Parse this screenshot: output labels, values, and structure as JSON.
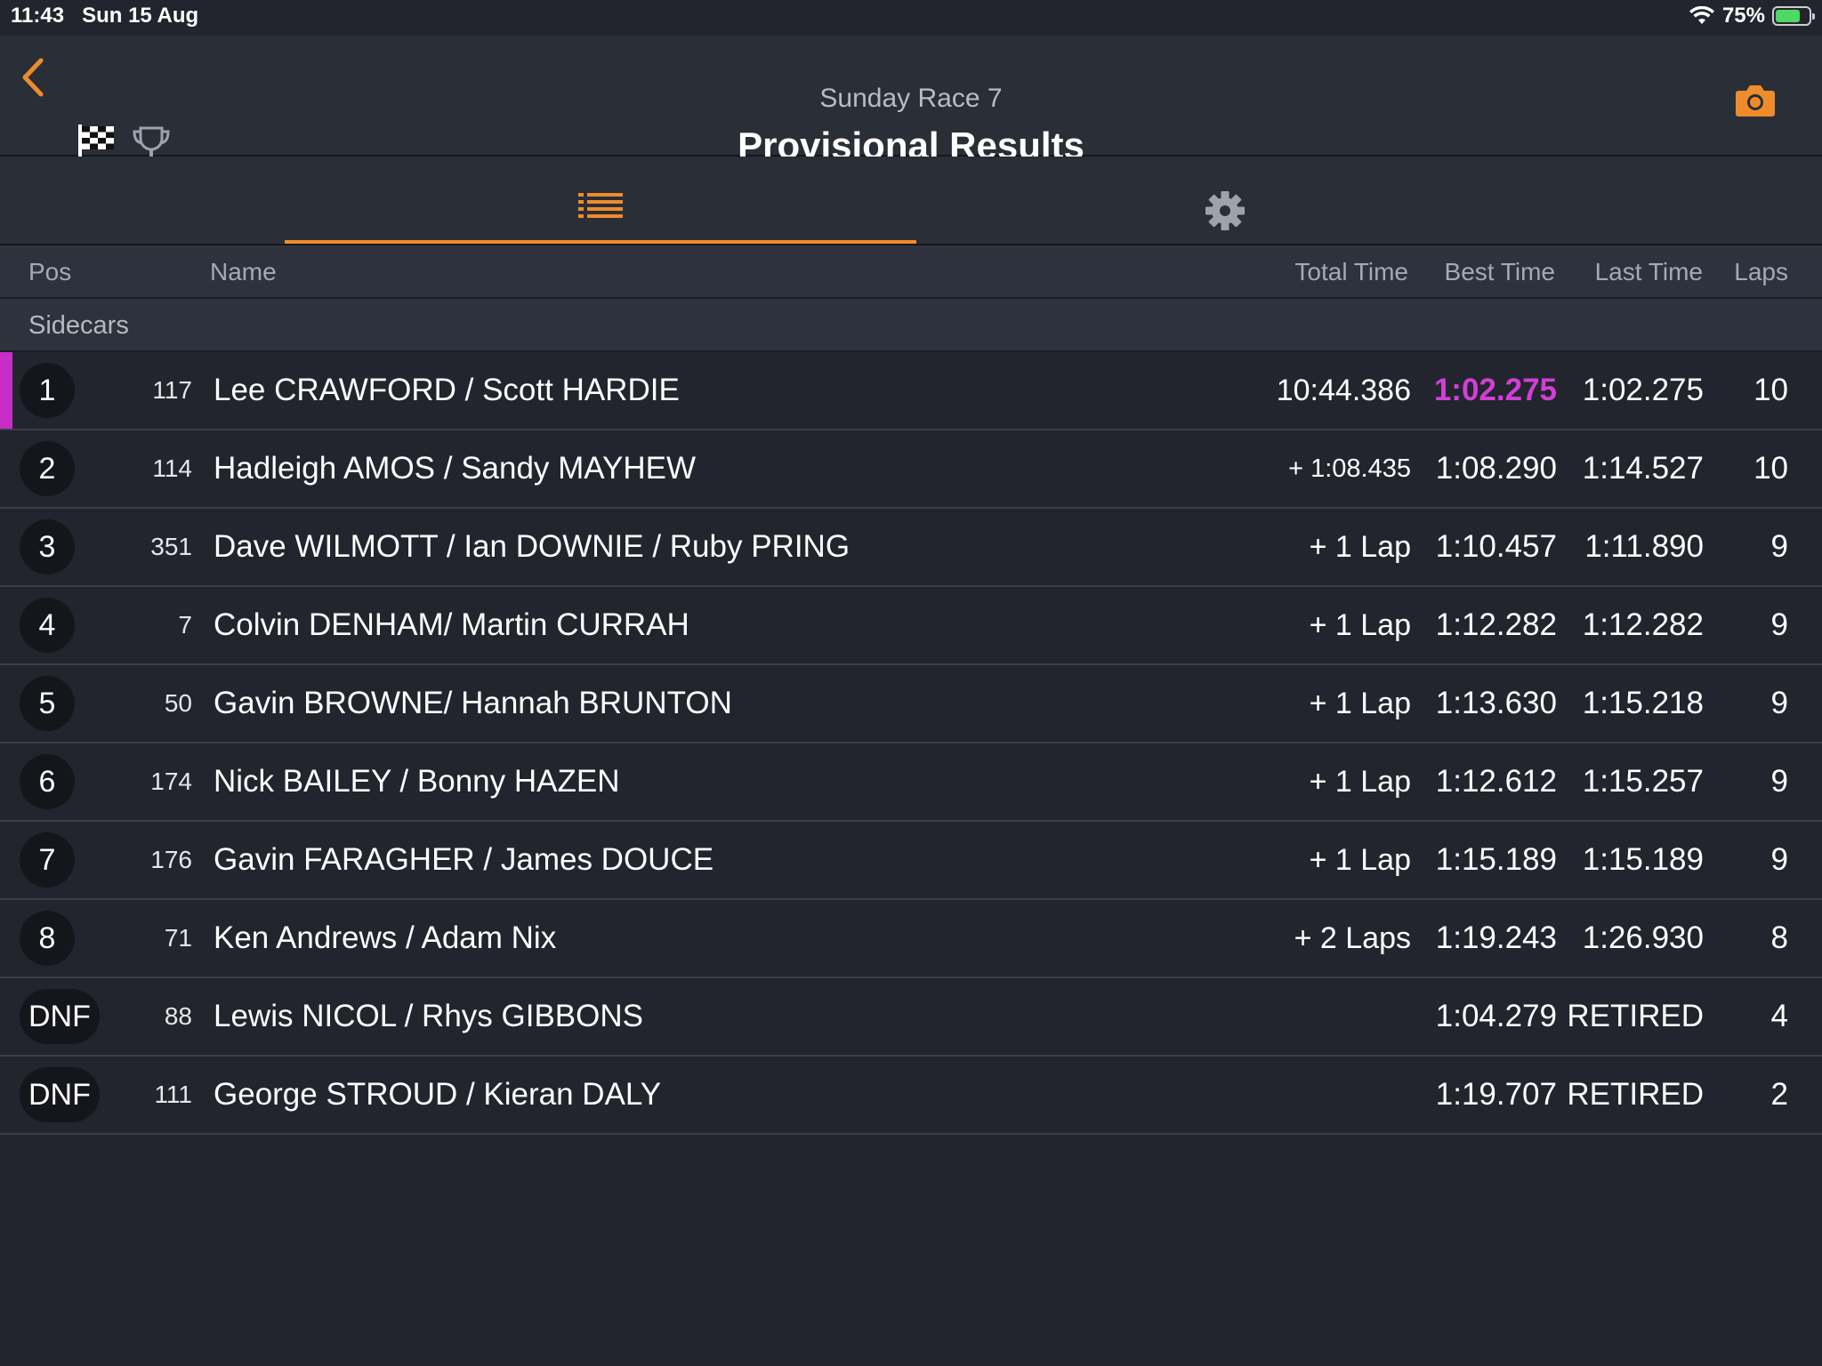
{
  "status_bar": {
    "time": "11:43",
    "date": "Sun 15 Aug",
    "battery": "75%",
    "battery_level": 0.75
  },
  "header": {
    "subtitle": "Sunday Race 7",
    "title": "Provisional Results"
  },
  "icons": {
    "back": "chevron-left-icon",
    "flag": "checkered-flag-icon",
    "trophy": "trophy-icon",
    "camera": "camera-icon",
    "list": "list-icon",
    "settings": "gear-icon"
  },
  "colors": {
    "accent": "#ee8c2c",
    "fastest": "#d23fd6",
    "background": "#22252e"
  },
  "columns": {
    "pos": "Pos",
    "name": "Name",
    "total": "Total Time",
    "best": "Best Time",
    "last": "Last Time",
    "laps": "Laps"
  },
  "group": "Sidecars",
  "rows": [
    {
      "pos": "1",
      "num": "117",
      "name": "Lee CRAWFORD / Scott HARDIE",
      "total": "10:44.386",
      "best": "1:02.275",
      "last": "1:02.275",
      "laps": "10"
    },
    {
      "pos": "2",
      "num": "114",
      "name": "Hadleigh AMOS / Sandy MAYHEW",
      "total": "+ 1:08.435",
      "best": "1:08.290",
      "last": "1:14.527",
      "laps": "10"
    },
    {
      "pos": "3",
      "num": "351",
      "name": "Dave WILMOTT / Ian DOWNIE / Ruby PRING",
      "total": "+ 1 Lap",
      "best": "1:10.457",
      "last": "1:11.890",
      "laps": "9"
    },
    {
      "pos": "4",
      "num": "7",
      "name": "Colvin DENHAM/ Martin CURRAH",
      "total": "+ 1 Lap",
      "best": "1:12.282",
      "last": "1:12.282",
      "laps": "9"
    },
    {
      "pos": "5",
      "num": "50",
      "name": "Gavin BROWNE/ Hannah BRUNTON",
      "total": "+ 1 Lap",
      "best": "1:13.630",
      "last": "1:15.218",
      "laps": "9"
    },
    {
      "pos": "6",
      "num": "174",
      "name": "Nick BAILEY / Bonny HAZEN",
      "total": "+ 1 Lap",
      "best": "1:12.612",
      "last": "1:15.257",
      "laps": "9"
    },
    {
      "pos": "7",
      "num": "176",
      "name": "Gavin FARAGHER / James DOUCE",
      "total": "+ 1 Lap",
      "best": "1:15.189",
      "last": "1:15.189",
      "laps": "9"
    },
    {
      "pos": "8",
      "num": "71",
      "name": "Ken Andrews / Adam Nix",
      "total": "+ 2 Laps",
      "best": "1:19.243",
      "last": "1:26.930",
      "laps": "8"
    },
    {
      "pos": "DNF",
      "num": "88",
      "name": "Lewis NICOL / Rhys GIBBONS",
      "total": "",
      "best": "1:04.279",
      "last": "RETIRED",
      "laps": "4"
    },
    {
      "pos": "DNF",
      "num": "111",
      "name": "George STROUD / Kieran DALY",
      "total": "",
      "best": "1:19.707",
      "last": "RETIRED",
      "laps": "2"
    }
  ]
}
